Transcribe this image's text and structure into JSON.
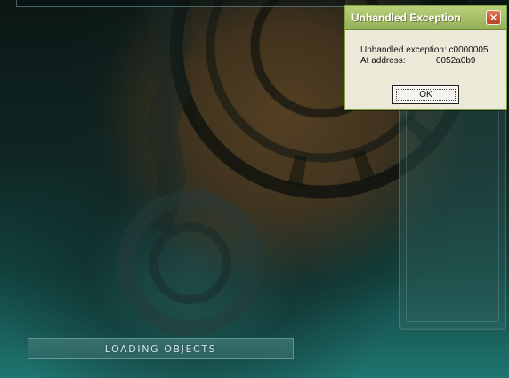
{
  "loading": {
    "label": "LOADING OBJECTS"
  },
  "dialog": {
    "title": "Unhandled Exception",
    "message_line_1": "Unhandled exception: c0000005",
    "message_line_2_label": "At address:",
    "message_line_2_value": "0052a0b9",
    "ok_label": "OK",
    "close_symbol": "✕"
  }
}
